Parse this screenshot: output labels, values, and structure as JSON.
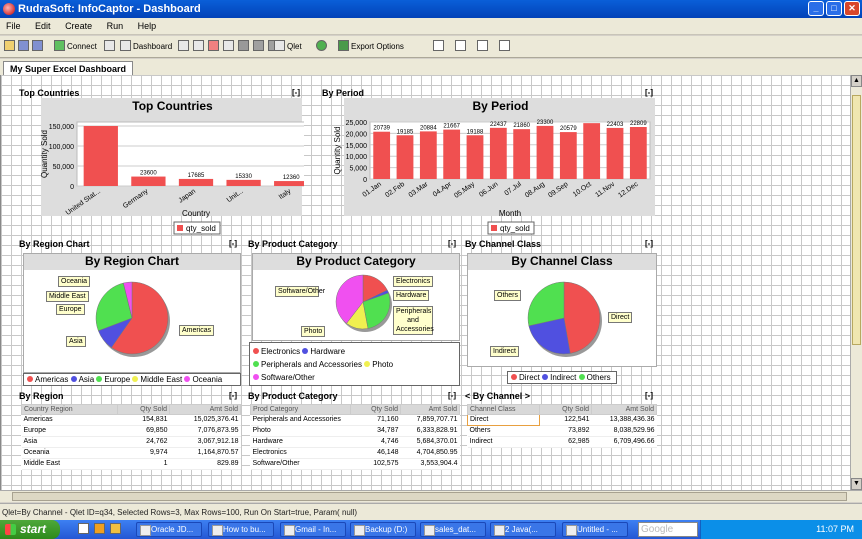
{
  "window": {
    "title": "RudraSoft: InfoCaptor - Dashboard"
  },
  "menu": [
    "File",
    "Edit",
    "Create",
    "Run",
    "Help"
  ],
  "toolbar": {
    "connect": "Connect",
    "dashboard": "Dashboard",
    "qlet": "Qlet",
    "export": "Export Options"
  },
  "tab": "My Super Excel Dashboard",
  "panels": {
    "top_countries": {
      "header": "Top Countries",
      "min": "[-]",
      "xlabel": "Country",
      "ylabel": "Quantity Sold",
      "legend": "qty_sold"
    },
    "by_period": {
      "header": "By Period",
      "min": "[-]",
      "xlabel": "Month",
      "ylabel": "Quantity Sold",
      "legend": "qty_sold"
    },
    "by_region_chart": {
      "header": "By Region Chart",
      "min": "[-]"
    },
    "by_product_category_chart": {
      "header": "By Product Category",
      "min": "[-]"
    },
    "by_channel_class_chart": {
      "header": "By Channel Class",
      "min": "[-]"
    },
    "by_region_table": {
      "header": "By Region",
      "min": "[-]"
    },
    "by_product_table": {
      "header": "By Product Category",
      "min": "[-]"
    },
    "by_channel_table": {
      "header": "< By Channel >",
      "min": "[-]"
    }
  },
  "chart_data": [
    {
      "type": "bar",
      "title": "Top Countries",
      "categories": [
        "United Stat...",
        "Germany",
        "Japan",
        "Unit...",
        "Italy"
      ],
      "values": [
        150000,
        23600,
        17685,
        15330,
        12360
      ],
      "data_labels": [
        "",
        "23600",
        "17685",
        "15330",
        "12360"
      ],
      "ylim": [
        0,
        160000
      ],
      "yticks": [
        "0",
        "50,000",
        "100,000",
        "150,000"
      ],
      "xlabel": "Country",
      "ylabel": "Quantity Sold",
      "legend": [
        "qty_sold"
      ],
      "color": "#f05050"
    },
    {
      "type": "bar",
      "title": "By Period",
      "categories": [
        "01.Jan",
        "02.Feb",
        "03.Mar",
        "04.Apr",
        "05.May",
        "06.Jun",
        "07.Jul",
        "08.Aug",
        "09.Sep",
        "10.Oct",
        "11.Nov",
        "12.Dec"
      ],
      "values": [
        20739,
        19185,
        20884,
        21667,
        19188,
        22437,
        21860,
        23300,
        20579,
        24500,
        22403,
        22809
      ],
      "data_labels": [
        "20739",
        "19185",
        "20884",
        "21667",
        "19188",
        "22437",
        "21860",
        "23300",
        "20579",
        "",
        "22403",
        "22809"
      ],
      "ylim": [
        0,
        25000
      ],
      "yticks": [
        "0",
        "5,000",
        "10,000",
        "15,000",
        "20,000",
        "25,000"
      ],
      "xlabel": "Month",
      "ylabel": "Quantity Sold",
      "legend": [
        "qty_sold"
      ],
      "color": "#f05050"
    },
    {
      "type": "pie",
      "title": "By Region Chart",
      "labels": [
        "Americas",
        "Asia",
        "Europe",
        "Middle East",
        "Oceania"
      ],
      "values": [
        154831,
        24762,
        69850,
        1,
        9974
      ],
      "colors": [
        "#f05050",
        "#5050e0",
        "#50e050",
        "#f0f050",
        "#f050f0"
      ]
    },
    {
      "type": "pie",
      "title": "By Product Category",
      "labels": [
        "Electronics",
        "Hardware",
        "Peripherals and Accessories",
        "Photo",
        "Software/Other"
      ],
      "values": [
        46148,
        4746,
        71160,
        34787,
        102575
      ],
      "colors": [
        "#f05050",
        "#5050e0",
        "#50e050",
        "#f0f050",
        "#f050f0"
      ]
    },
    {
      "type": "pie",
      "title": "By Channel Class",
      "labels": [
        "Direct",
        "Indirect",
        "Others"
      ],
      "values": [
        122541,
        62985,
        73892
      ],
      "colors": [
        "#f05050",
        "#5050e0",
        "#50e050"
      ]
    }
  ],
  "legends": {
    "region": [
      "Americas",
      "Asia",
      "Europe",
      "Middle East",
      "Oceania"
    ],
    "product": [
      "Electronics",
      "Hardware",
      "Peripherals and Accessories",
      "Photo",
      "Software/Other"
    ],
    "channel": [
      "Direct",
      "Indirect",
      "Others"
    ]
  },
  "callouts": {
    "region": [
      "Oceania",
      "Middle East",
      "Europe",
      "Americas",
      "Asia"
    ],
    "product": [
      "Software/Other",
      "Electronics",
      "Hardware",
      "Peripherals and Accessories",
      "Photo"
    ],
    "channel": [
      "Others",
      "Direct",
      "Indirect"
    ]
  },
  "tables": {
    "region": {
      "headers": [
        "Country Region",
        "Qty Sold",
        "Amt Sold"
      ],
      "rows": [
        [
          "Americas",
          "154,831",
          "15,025,376.41"
        ],
        [
          "Europe",
          "69,850",
          "7,076,873.95"
        ],
        [
          "Asia",
          "24,762",
          "3,067,912.18"
        ],
        [
          "Oceania",
          "9,974",
          "1,164,870.57"
        ],
        [
          "Middle East",
          "1",
          "829.89"
        ]
      ]
    },
    "product": {
      "headers": [
        "Prod Category",
        "Qty Sold",
        "Amt Sold"
      ],
      "rows": [
        [
          "Peripherals and Accessories",
          "71,160",
          "7,859,707.71"
        ],
        [
          "Photo",
          "34,787",
          "6,333,828.91"
        ],
        [
          "Hardware",
          "4,746",
          "5,684,370.01"
        ],
        [
          "Electronics",
          "46,148",
          "4,704,850.95"
        ],
        [
          "Software/Other",
          "102,575",
          "3,553,904.4"
        ]
      ]
    },
    "channel": {
      "headers": [
        "Channel Class",
        "Qty Sold",
        "Amt Sold"
      ],
      "rows": [
        [
          "Direct",
          "122,541",
          "13,388,436.36"
        ],
        [
          "Others",
          "73,892",
          "8,038,529.96"
        ],
        [
          "Indirect",
          "62,985",
          "6,709,496.66"
        ]
      ]
    }
  },
  "status": "Qlet=By Channel - Qlet ID=q34, Selected Rows=3, Max Rows=100, Run On Start=true, Param( null)",
  "taskbar": {
    "start": "start",
    "search_placeholder": "Google",
    "clock": "11:07 PM",
    "items": [
      "Oracle JD...",
      "How to bu...",
      "Gmail - In...",
      "Backup (D:)",
      "sales_dat...",
      "2 Java(...",
      "Untitled - ..."
    ]
  }
}
